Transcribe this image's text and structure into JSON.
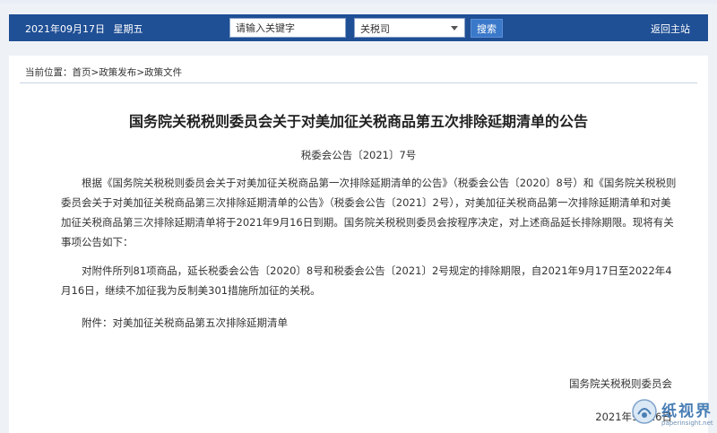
{
  "header": {
    "date": "2021年09月17日",
    "weekday": "星期五",
    "search_placeholder": "请输入关键字",
    "category_selected": "关税司",
    "search_label": "搜索",
    "home_label": "返回主站"
  },
  "breadcrumb": {
    "label": "当前位置：",
    "items": [
      "首页",
      "政策发布",
      "政策文件"
    ]
  },
  "article": {
    "title": "国务院关税税则委员会关于对美加征关税商品第五次排除延期清单的公告",
    "doc_no": "税委会公告〔2021〕7号",
    "paragraphs": [
      "根据《国务院关税税则委员会关于对美加征关税商品第一次排除延期清单的公告》（税委会公告〔2020〕8号）和《国务院关税税则委员会关于对美加征关税商品第三次排除延期清单的公告》（税委会公告〔2021〕2号），对美加征关税商品第一次排除延期清单和对美加征关税商品第三次排除延期清单将于2021年9月16日到期。国务院关税税则委员会按程序决定，对上述商品延长排除期限。现将有关事项公告如下：",
      "对附件所列81项商品，延长税委会公告〔2020〕8号和税委会公告〔2021〕2号规定的排除期限，自2021年9月17日至2022年4月16日，继续不加征我为反制美301措施所加征的关税。",
      "附件：对美加征关税商品第五次排除延期清单"
    ],
    "signature_org": "国务院关税税则委员会",
    "signature_date": "2021年9月16日"
  },
  "watermark": {
    "text": "纸视界",
    "url": "paperinsight.net"
  },
  "colors": {
    "nav_bg": "#1f4f95",
    "button_bg": "#3a78c9",
    "page_bg": "#eef2f7"
  }
}
